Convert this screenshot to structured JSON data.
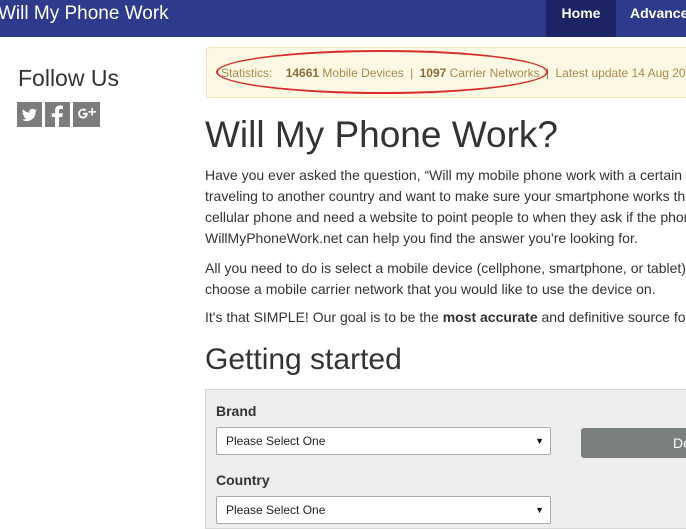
{
  "header": {
    "brand": "Will My Phone Work",
    "nav": {
      "home": "Home",
      "advanced": "Advance"
    }
  },
  "sidebar": {
    "follow_title": "Follow Us",
    "social_icons": [
      "twitter-icon",
      "facebook-icon",
      "google-plus-icon"
    ]
  },
  "stats": {
    "label": "Statistics:",
    "devices_count": "14661",
    "devices_label": "Mobile Devices",
    "sep": "|",
    "networks_count": "1097",
    "networks_label": "Carrier Networks",
    "update_text": "Latest update 14 Aug 201"
  },
  "main": {
    "title": "Will My Phone Work?",
    "intro_lines": [
      "Have you ever asked the question, “Will my mobile phone work with a certain",
      "traveling to another country and want to make sure your smartphone works th",
      "cellular phone and need a website to point people to when they ask if the phor",
      "WillMyPhoneWork.net can help you find the answer you're looking for."
    ],
    "para2_lines": [
      "All you need to do is select a mobile device (cellphone, smartphone, or tablet)",
      "choose a mobile carrier network that you would like to use the device on."
    ],
    "para3_before": "It's that SIMPLE! Our goal is to be the ",
    "para3_bold": "most accurate",
    "para3_after": " and definitive source fo",
    "getting_started": "Getting started"
  },
  "form": {
    "brand_label": "Brand",
    "brand_value": "Please Select One",
    "country_label": "Country",
    "country_value": "Please Select One",
    "detect_label": "De"
  },
  "colors": {
    "nav_bg": "#2e3a8c",
    "nav_active": "#1c2466",
    "stats_bg": "#fcf8e3",
    "highlight_circle": "#d82d2d",
    "button_bg": "#7a7f7f"
  }
}
